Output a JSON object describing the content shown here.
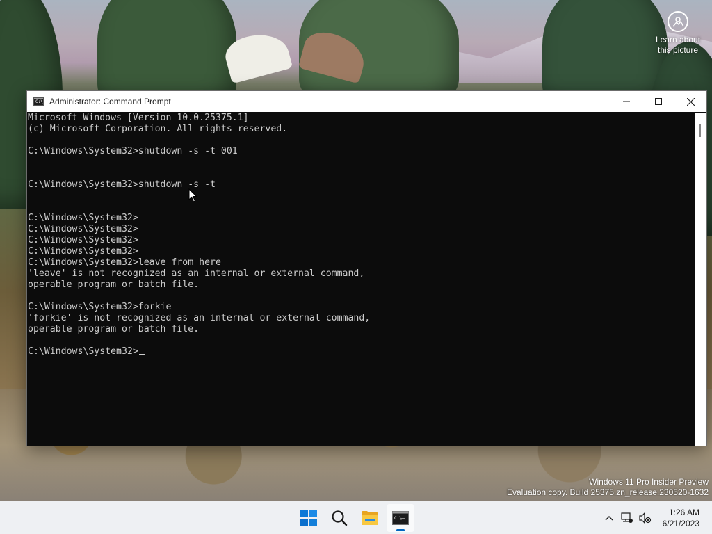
{
  "desktop": {
    "learn_about_line1": "Learn about",
    "learn_about_line2": "this picture",
    "watermark_line1": "Windows 11 Pro Insider Preview",
    "watermark_line2": "Evaluation copy. Build 25375.zn_release.230520-1632"
  },
  "window": {
    "title": "Administrator: Command Prompt",
    "console_lines": [
      "Microsoft Windows [Version 10.0.25375.1]",
      "(c) Microsoft Corporation. All rights reserved.",
      "",
      "C:\\Windows\\System32>shutdown -s -t 001",
      "",
      "",
      "C:\\Windows\\System32>shutdown -s -t",
      "",
      "",
      "C:\\Windows\\System32>",
      "C:\\Windows\\System32>",
      "C:\\Windows\\System32>",
      "C:\\Windows\\System32>",
      "C:\\Windows\\System32>leave from here",
      "'leave' is not recognized as an internal or external command,",
      "operable program or batch file.",
      "",
      "C:\\Windows\\System32>forkie",
      "'forkie' is not recognized as an internal or external command,",
      "operable program or batch file.",
      ""
    ],
    "current_prompt": "C:\\Windows\\System32>",
    "console_bg": "#0c0c0c",
    "console_fg": "#cccccc"
  },
  "taskbar": {
    "items": [
      {
        "icon": "windows-start-icon"
      },
      {
        "icon": "search-icon"
      },
      {
        "icon": "file-explorer-icon"
      },
      {
        "icon": "terminal-icon",
        "active": true
      }
    ],
    "tray_icons": [
      "chevron-up-icon",
      "network-icon",
      "volume-muted-icon"
    ],
    "time": "1:26 AM",
    "date": "6/21/2023",
    "accent": "#0067c0"
  }
}
